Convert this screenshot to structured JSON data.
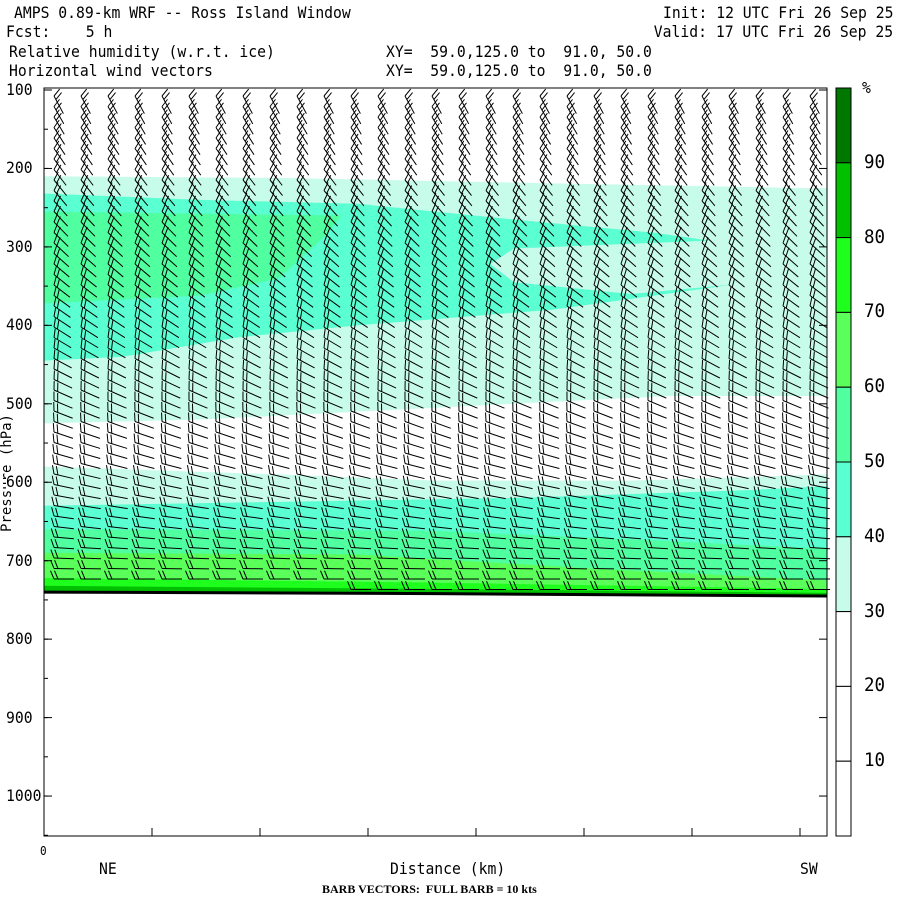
{
  "header": {
    "title": "AMPS 0.89-km WRF -- Ross Island Window",
    "init": "Init: 12 UTC Fri 26 Sep 25",
    "fcst": "Fcst:    5 h",
    "valid": "Valid: 17 UTC Fri 26 Sep 25",
    "field1": "Relative humidity (w.r.t. ice)",
    "field1_xy": "XY=  59.0,125.0 to  91.0, 50.0",
    "field2": "Horizontal wind vectors",
    "field2_xy": "XY=  59.0,125.0 to  91.0, 50.0"
  },
  "footer": {
    "x_origin": "0",
    "left_dir": "NE",
    "xlabel": "Distance (km)",
    "right_dir": "SW",
    "barb_note": "BARB VECTORS:  FULL BARB = 10 kts"
  },
  "chart_data": {
    "type": "heatmap",
    "title": "Relative humidity (w.r.t. ice) cross-section with wind barbs",
    "xlabel": "Distance (km)",
    "ylabel": "Pressure (hPa)",
    "yticks": [
      "100",
      "200",
      "300",
      "400",
      "500",
      "600",
      "700",
      "800",
      "900",
      "1000"
    ],
    "ytick_values": [
      100,
      200,
      300,
      400,
      500,
      600,
      700,
      800,
      900,
      1000
    ],
    "ylim": [
      100,
      1050
    ],
    "xlim_fraction": [
      0,
      1
    ],
    "x_tick_count": 8,
    "surface_pressure": [
      [
        0,
        740
      ],
      [
        0.5,
        742
      ],
      [
        1,
        745
      ]
    ],
    "colorbar": {
      "unit": "%",
      "levels": [
        "10",
        "20",
        "30",
        "40",
        "50",
        "60",
        "70",
        "80",
        "90"
      ],
      "colors": [
        "#ffffff",
        "#ffffff",
        "#ffffff",
        "#c8fcea",
        "#5affd2",
        "#50ffa0",
        "#5aff5a",
        "#1eff1e",
        "#00c000",
        "#007800"
      ]
    },
    "rh_regions": [
      {
        "level": 30,
        "color": "#c8fcea",
        "points": [
          [
            0,
            210
          ],
          [
            0.3,
            212
          ],
          [
            0.6,
            218
          ],
          [
            0.97,
            225
          ],
          [
            1,
            225
          ],
          [
            1,
            490
          ],
          [
            0.8,
            490
          ],
          [
            0.6,
            500
          ],
          [
            0.4,
            510
          ],
          [
            0.2,
            520
          ],
          [
            0,
            525
          ]
        ]
      },
      {
        "level": 30,
        "color": "#c8fcea",
        "points": [
          [
            0,
            580
          ],
          [
            0.3,
            590
          ],
          [
            0.5,
            598
          ],
          [
            0.75,
            598
          ],
          [
            1,
            590
          ],
          [
            1,
            745
          ],
          [
            0,
            740
          ]
        ]
      },
      {
        "level": 40,
        "color": "#5affd2",
        "points": [
          [
            0,
            232
          ],
          [
            0.2,
            240
          ],
          [
            0.4,
            245
          ],
          [
            0.6,
            265
          ],
          [
            0.78,
            282
          ],
          [
            0.85,
            292
          ],
          [
            0.75,
            296
          ],
          [
            0.6,
            302
          ],
          [
            0.57,
            322
          ],
          [
            0.6,
            345
          ],
          [
            0.75,
            360
          ],
          [
            0.88,
            348
          ],
          [
            0.65,
            380
          ],
          [
            0.4,
            400
          ],
          [
            0.25,
            415
          ],
          [
            0.1,
            440
          ],
          [
            0,
            445
          ]
        ]
      },
      {
        "level": 40,
        "color": "#5affd2",
        "points": [
          [
            0,
            630
          ],
          [
            0.3,
            625
          ],
          [
            0.6,
            620
          ],
          [
            0.9,
            610
          ],
          [
            1,
            605
          ],
          [
            1,
            745
          ],
          [
            0,
            740
          ]
        ]
      },
      {
        "level": 50,
        "color": "#50ffa0",
        "points": [
          [
            0,
            255
          ],
          [
            0.38,
            260
          ],
          [
            0.36,
            285
          ],
          [
            0.3,
            340
          ],
          [
            0.2,
            362
          ],
          [
            0,
            372
          ]
        ]
      },
      {
        "level": 50,
        "color": "#50ffa0",
        "points": [
          [
            0,
            660
          ],
          [
            0.5,
            662
          ],
          [
            0.8,
            675
          ],
          [
            1,
            685
          ],
          [
            1,
            745
          ],
          [
            0,
            740
          ]
        ]
      },
      {
        "level": 60,
        "color": "#5aff5a",
        "points": [
          [
            0,
            690
          ],
          [
            0.4,
            692
          ],
          [
            0.7,
            710
          ],
          [
            1,
            725
          ],
          [
            1,
            745
          ],
          [
            0,
            740
          ]
        ]
      },
      {
        "level": 70,
        "color": "#1eff1e",
        "points": [
          [
            0,
            722
          ],
          [
            0.5,
            728
          ],
          [
            1,
            736
          ],
          [
            1,
            745
          ],
          [
            0,
            740
          ]
        ]
      },
      {
        "level": 80,
        "color": "#00c000",
        "points": [
          [
            0,
            732
          ],
          [
            0.5,
            736
          ],
          [
            1,
            741
          ],
          [
            1,
            745
          ],
          [
            0,
            740
          ]
        ]
      }
    ],
    "wind": {
      "full_barb_kts": 10,
      "typical_speed_kts": 20
    }
  }
}
